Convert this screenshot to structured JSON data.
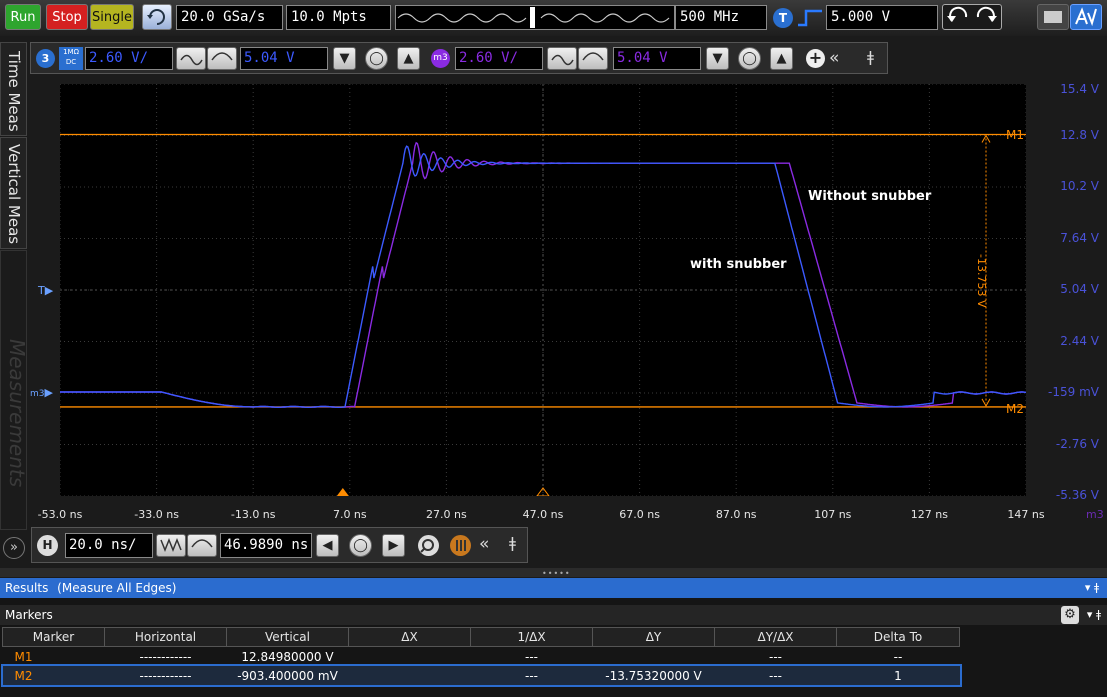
{
  "toolbar": {
    "run": "Run",
    "stop": "Stop",
    "single": "Single",
    "sample_rate": "20.0 GSa/s",
    "memory_depth": "10.0 Mpts",
    "bandwidth": "500 MHz",
    "trigger_label": "T",
    "trigger_level": "5.000 V",
    "colors": {
      "run": "#2ea52e",
      "stop": "#d42020",
      "single": "#c8c820"
    }
  },
  "channel_bar": {
    "ch3_label": "3",
    "ch3_coupling_top": "1MΩ",
    "ch3_coupling_bottom": "DC",
    "ch3_scale": "2.60 V/",
    "ch3_offset": "5.04 V",
    "m3_label": "m3",
    "m3_scale": "2.60 V/",
    "m3_offset": "5.04 V"
  },
  "side_tabs": {
    "time_meas": "Time Meas",
    "vertical_meas": "Vertical Meas",
    "measurements": "Measurements"
  },
  "graticule": {
    "y_labels": [
      "15.4 V",
      "12.8 V",
      "10.2 V",
      "7.64 V",
      "5.04 V",
      "2.44 V",
      "-159 mV",
      "-2.76 V",
      "-5.36 V"
    ],
    "x_labels": [
      "-53.0 ns",
      "-33.0 ns",
      "-13.0 ns",
      "7.0 ns",
      "27.0 ns",
      "47.0 ns",
      "67.0 ns",
      "87.0 ns",
      "107 ns",
      "127 ns",
      "147 ns"
    ],
    "x_unit_label": "m3",
    "trigger_marker": "T",
    "ch_marker": "m3",
    "marker1_label": "M1",
    "marker2_label": "M2",
    "delta_label": "-13.753 V",
    "annotation_without": "Without snubber",
    "annotation_with": "with snubber",
    "trace_colors": {
      "with_snubber": "#3c5aff",
      "without_snubber": "#8a2be2",
      "markers": "#ff8c00"
    }
  },
  "horizontal_bar": {
    "h_label": "H",
    "time_scale": "20.0 ns/",
    "position": "46.9890 ns"
  },
  "results": {
    "title": "Results",
    "subtitle": "(Measure All Edges)",
    "markers_title": "Markers",
    "columns": [
      "Marker",
      "Horizontal",
      "Vertical",
      "ΔX",
      "1/ΔX",
      "ΔY",
      "ΔY/ΔX",
      "Delta To"
    ],
    "rows": [
      [
        "M1",
        "------------",
        "12.84980000 V",
        "",
        "---",
        "",
        "---",
        "--"
      ],
      [
        "M2",
        "------------",
        "-903.400000 mV",
        "",
        "---",
        "-13.75320000 V",
        "---",
        "1"
      ]
    ]
  }
}
